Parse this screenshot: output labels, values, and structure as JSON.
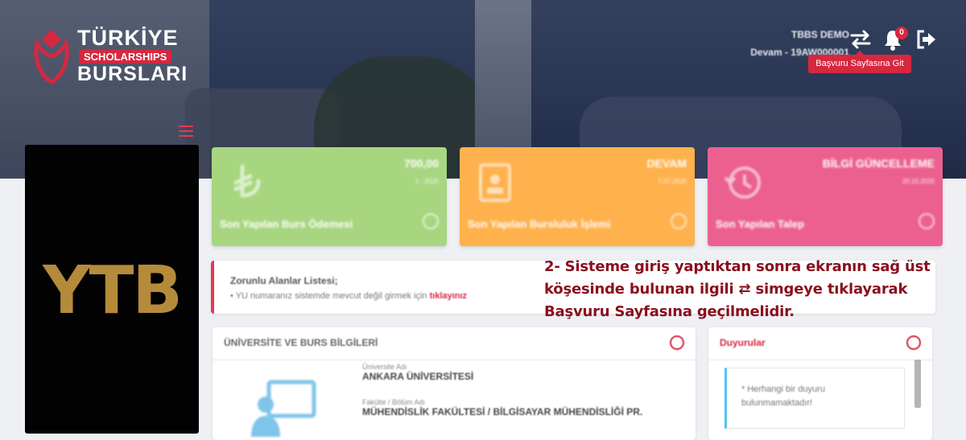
{
  "header": {
    "logo": {
      "line1": "TÜRKİYE",
      "line2": "SCHOLARSHIPS",
      "line3": "BURSLARI"
    },
    "user_name": "TBBS DEMO",
    "user_status": "Devam - 19AW000001",
    "notification_count": "0",
    "tooltip": "Başvuru Sayfasına Git",
    "icons": [
      "switch-arrows-icon",
      "bell-icon",
      "logout-icon"
    ]
  },
  "sidebar": {
    "logo_text": "YTB"
  },
  "cards": [
    {
      "big": "700,00",
      "small": "1 - 2020",
      "label": "Son Yapılan Burs Ödemesi",
      "color": "#a8d680",
      "icon": "lira-icon"
    },
    {
      "big": "DEVAM",
      "small": "7.07.2020",
      "label": "Son Yapılan Bursluluk İşlemi",
      "color": "#ffb14d",
      "icon": "id-card-icon"
    },
    {
      "big": "BİLGİ GÜNCELLEME",
      "small": "20.10.2020",
      "label": "Son Yapılan Talep",
      "color": "#ec6090",
      "icon": "history-icon"
    }
  ],
  "alert": {
    "title": "Zorunlu Alanlar Listesi;",
    "text": "• YU numaranız sistemde mevcut değil girmek için",
    "link": "tıklayınız"
  },
  "university_panel": {
    "title": "ÜNİVERSİTE VE BURS BİLGİLERİ",
    "fields": [
      {
        "label": "Üniversite Adı",
        "value": "ANKARA ÜNİVERSİTESİ"
      },
      {
        "label": "Fakülte / Bölüm Adı",
        "value": "MÜHENDİSLİK FAKÜLTESİ / BİLGİSAYAR MÜHENDİSLİĞİ PR."
      }
    ]
  },
  "announcements": {
    "title": "Duyurular",
    "item": "* Herhangi bir duyuru bulunmamaktadır!"
  },
  "instruction": "2- Sisteme giriş yaptıktan sonra ekranın sağ üst köşesinde bulunan ilgili ⇄ simgeye tıklayarak Başvuru Sayfasına geçilmelidir."
}
